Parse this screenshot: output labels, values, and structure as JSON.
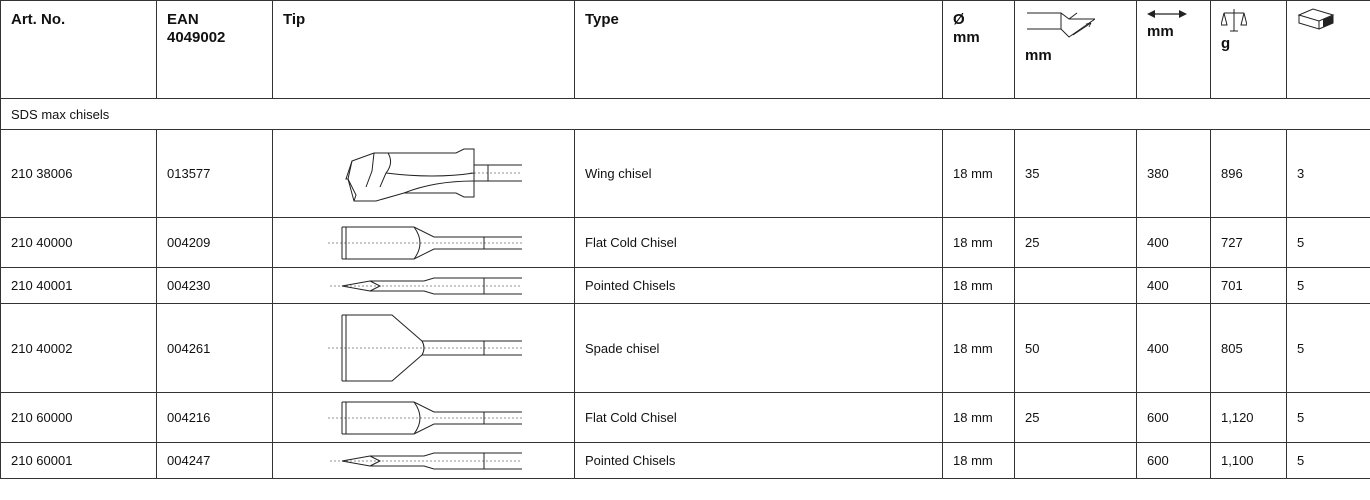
{
  "header": {
    "art_no": "Art. No.",
    "ean_line1": "EAN",
    "ean_line2": "4049002",
    "tip": "Tip",
    "type": "Type",
    "diameter_symbol": "Ø",
    "diameter_unit": "mm",
    "width_unit": "mm",
    "length_unit": "mm",
    "weight_unit": "g",
    "icons": {
      "width": "chisel-blade-width-icon",
      "length": "length-arrows-icon",
      "weight": "scale-icon",
      "package": "package-box-icon"
    }
  },
  "section": {
    "title": "SDS max chisels"
  },
  "rows": [
    {
      "art_no": "210 38006",
      "ean": "013577",
      "tip_icon": "wing-chisel-icon",
      "type": "Wing chisel",
      "diameter": "18 mm",
      "width": "35",
      "length": "380",
      "weight": "896",
      "package": "3"
    },
    {
      "art_no": "210 40000",
      "ean": "004209",
      "tip_icon": "flat-chisel-icon",
      "type": "Flat Cold Chisel",
      "diameter": "18 mm",
      "width": "25",
      "length": "400",
      "weight": "727",
      "package": "5"
    },
    {
      "art_no": "210 40001",
      "ean": "004230",
      "tip_icon": "pointed-chisel-icon",
      "type": "Pointed Chisels",
      "diameter": "18 mm",
      "width": "",
      "length": "400",
      "weight": "701",
      "package": "5"
    },
    {
      "art_no": "210 40002",
      "ean": "004261",
      "tip_icon": "spade-chisel-icon",
      "type": "Spade chisel",
      "diameter": "18 mm",
      "width": "50",
      "length": "400",
      "weight": "805",
      "package": "5"
    },
    {
      "art_no": "210 60000",
      "ean": "004216",
      "tip_icon": "flat-chisel-icon",
      "type": "Flat Cold Chisel",
      "diameter": "18 mm",
      "width": "25",
      "length": "600",
      "weight": "1,120",
      "package": "5"
    },
    {
      "art_no": "210 60001",
      "ean": "004247",
      "tip_icon": "pointed-chisel-icon",
      "type": "Pointed Chisels",
      "diameter": "18 mm",
      "width": "",
      "length": "600",
      "weight": "1,100",
      "package": "5"
    }
  ]
}
